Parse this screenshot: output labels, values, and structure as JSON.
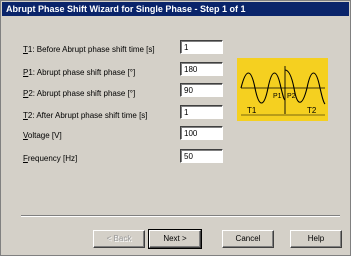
{
  "window": {
    "title": "Abrupt Phase Shift Wizard for Single Phase - Step 1 of 1"
  },
  "fields": [
    {
      "accel": "T",
      "rest": "1: Before Abrupt phase shift time [s]",
      "value": "1"
    },
    {
      "accel": "P",
      "rest": "1: Abrupt phase shift phase [°]",
      "value": "180"
    },
    {
      "accel": "P",
      "rest": "2: Abrupt phase shift phase [°]",
      "value": "90"
    },
    {
      "accel": "T",
      "rest": "2: After Abrupt phase shift time [s]",
      "value": "1"
    },
    {
      "accel": "V",
      "rest": "oltage [V]",
      "value": "100"
    },
    {
      "accel": "F",
      "rest": "requency [Hz]",
      "value": "50"
    }
  ],
  "graphic": {
    "t1": "T1",
    "t2": "T2",
    "p1": "P1",
    "p2": "P2",
    "background": "#f5d020",
    "wave_color": "#000000"
  },
  "buttons": {
    "back": "< Back",
    "next": "Next >",
    "cancel": "Cancel",
    "help": "Help"
  },
  "colors": {
    "titlebar": "#0a246a",
    "face": "#d4d0c8"
  }
}
